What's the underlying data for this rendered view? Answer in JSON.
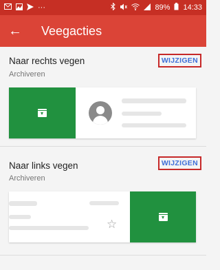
{
  "status_bar": {
    "dots": "···",
    "battery": "89%",
    "time": "14:33"
  },
  "app_bar": {
    "title": "Veegacties",
    "back_glyph": "←"
  },
  "sections": [
    {
      "title": "Naar rechts vegen",
      "subtitle": "Archiveren",
      "button": "WIJZIGEN",
      "direction": "right"
    },
    {
      "title": "Naar links vegen",
      "subtitle": "Archiveren",
      "button": "WIJZIGEN",
      "direction": "left"
    }
  ],
  "icons": {
    "star": "☆"
  },
  "colors": {
    "status_bar": "#c62f24",
    "app_bar": "#db4437",
    "archive_green": "#21913f",
    "button_text": "#3e6fd8",
    "button_border": "#c62828"
  }
}
